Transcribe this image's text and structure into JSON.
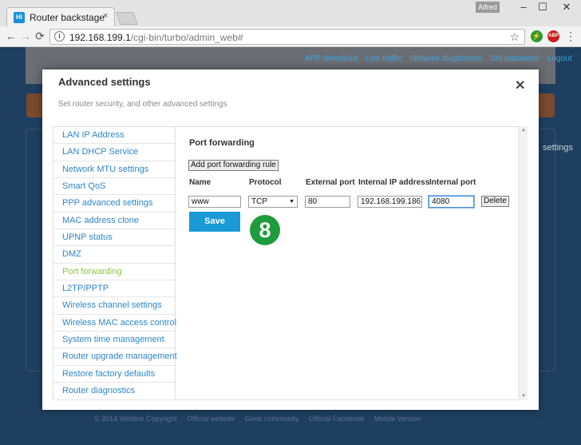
{
  "browser": {
    "tab_title": "Router backstage",
    "tab_favicon": "Hi",
    "tab_close": "×",
    "user_name": "Alfred",
    "window_minimize": "–",
    "window_maximize": "☐",
    "window_close": "✕",
    "nav_back": "←",
    "nav_forward": "→",
    "nav_reload": "⟳",
    "url_host": "192.168.199.1",
    "url_path": "/cgi-bin/turbo/admin_web#",
    "bookmark_star": "☆",
    "ext1_label": "⚡",
    "ext2_label": "ABP",
    "menu_dots": "⋮"
  },
  "background": {
    "links": [
      "APP download",
      "Live traffic",
      "Network diagnostics",
      "Set password",
      "Logout"
    ],
    "settings_label": "settings",
    "footer": [
      "© 2014 Wolilink Copyright",
      "Official website",
      "Geek community",
      "Official Facebook",
      "Mobile Version"
    ]
  },
  "modal": {
    "title": "Advanced settings",
    "subtitle": "Set router security, and other advanced settings",
    "close": "✕",
    "active_item": "Port forwarding"
  },
  "sidebar": {
    "items": [
      "LAN IP Address",
      "LAN DHCP Service",
      "Network MTU settings",
      "Smart QoS",
      "PPP advanced settings",
      "MAC address clone",
      "UPNP status",
      "DMZ",
      "Port forwarding",
      "L2TP/PPTP",
      "Wireless channel settings",
      "Wireless MAC access control",
      "System time management",
      "Router upgrade management",
      "Restore factory defaults",
      "Router diagnostics"
    ]
  },
  "port_forwarding": {
    "section_title": "Port forwarding",
    "add_rule_label": "Add port forwarding rule",
    "columns": {
      "name": "Name",
      "protocol": "Protocol",
      "external_port": "External port",
      "internal_ip": "Internal IP address",
      "internal_port": "Internal port"
    },
    "rule": {
      "name": "www",
      "protocol": "TCP",
      "external_port": "80",
      "internal_ip": "192.168.199.186",
      "internal_port": "4080"
    },
    "delete_label": "Delete",
    "save_label": "Save",
    "step_number": "8"
  },
  "colors": {
    "accent_blue": "#1a9ad6",
    "active_green": "#8cc63f",
    "step_badge": "#1e9b3a"
  }
}
